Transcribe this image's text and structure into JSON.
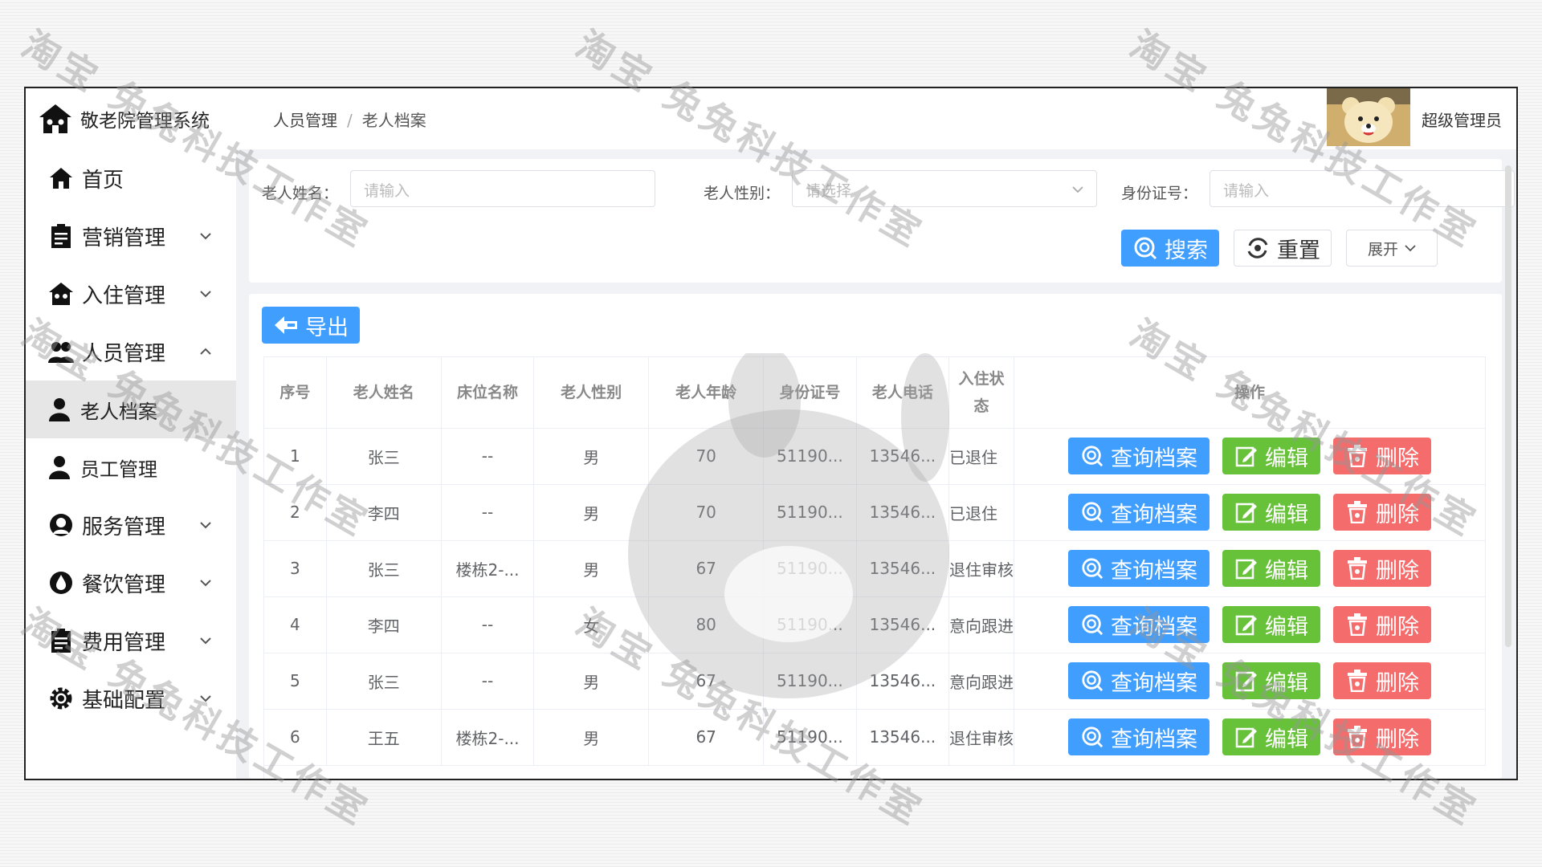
{
  "app": {
    "title": "敬老院管理系统"
  },
  "sidebar": {
    "items": [
      {
        "label": "首页",
        "icon": "home-icon",
        "has_children": false
      },
      {
        "label": "营销管理",
        "icon": "clipboard-icon",
        "has_children": true
      },
      {
        "label": "入住管理",
        "icon": "house-icon",
        "has_children": true
      },
      {
        "label": "人员管理",
        "icon": "people-icon",
        "has_children": true,
        "expanded": true
      },
      {
        "label": "老人档案",
        "icon": "person-icon",
        "sub": true,
        "active": true
      },
      {
        "label": "员工管理",
        "icon": "person-icon",
        "sub": true
      },
      {
        "label": "服务管理",
        "icon": "service-icon",
        "has_children": true
      },
      {
        "label": "餐饮管理",
        "icon": "drop-icon",
        "has_children": true
      },
      {
        "label": "费用管理",
        "icon": "clipboard-icon",
        "has_children": true
      },
      {
        "label": "基础配置",
        "icon": "gear-icon",
        "has_children": true
      }
    ]
  },
  "header": {
    "breadcrumb": [
      "人员管理",
      "老人档案"
    ],
    "breadcrumb_sep": "/",
    "user_name": "超级管理员"
  },
  "search": {
    "name_label": "老人姓名：",
    "name_placeholder": "请输入",
    "gender_label": "老人性别：",
    "gender_placeholder": "请选择",
    "id_label": "身份证号：",
    "id_placeholder": "请输入",
    "search_button": "搜索",
    "reset_button": "重置",
    "expand_button": "展开"
  },
  "toolbar": {
    "export_button": "导出"
  },
  "table": {
    "columns": [
      "序号",
      "老人姓名",
      "床位名称",
      "老人性别",
      "老人年龄",
      "身份证号",
      "老人电话",
      "入住状态",
      "操作"
    ],
    "rows": [
      [
        "1",
        "张三",
        "--",
        "男",
        "70",
        "51190...",
        "13546...",
        "已退住"
      ],
      [
        "2",
        "李四",
        "--",
        "男",
        "70",
        "51190...",
        "13546...",
        "已退住"
      ],
      [
        "3",
        "张三",
        "楼栋2-...",
        "男",
        "67",
        "51190...",
        "13546...",
        "退住审核"
      ],
      [
        "4",
        "李四",
        "--",
        "女",
        "80",
        "51190...",
        "13546...",
        "意向跟进"
      ],
      [
        "5",
        "张三",
        "--",
        "男",
        "67",
        "51190...",
        "13546...",
        "意向跟进"
      ],
      [
        "6",
        "王五",
        "楼栋2-...",
        "男",
        "67",
        "51190...",
        "13546...",
        "退住审核"
      ]
    ],
    "actions": {
      "query": "查询档案",
      "edit": "编辑",
      "delete": "删除"
    }
  },
  "watermark": {
    "text": "淘宝 兔兔科技工作室"
  },
  "colors": {
    "primary": "#409eff",
    "success": "#67c23a",
    "danger": "#f56c6c"
  }
}
